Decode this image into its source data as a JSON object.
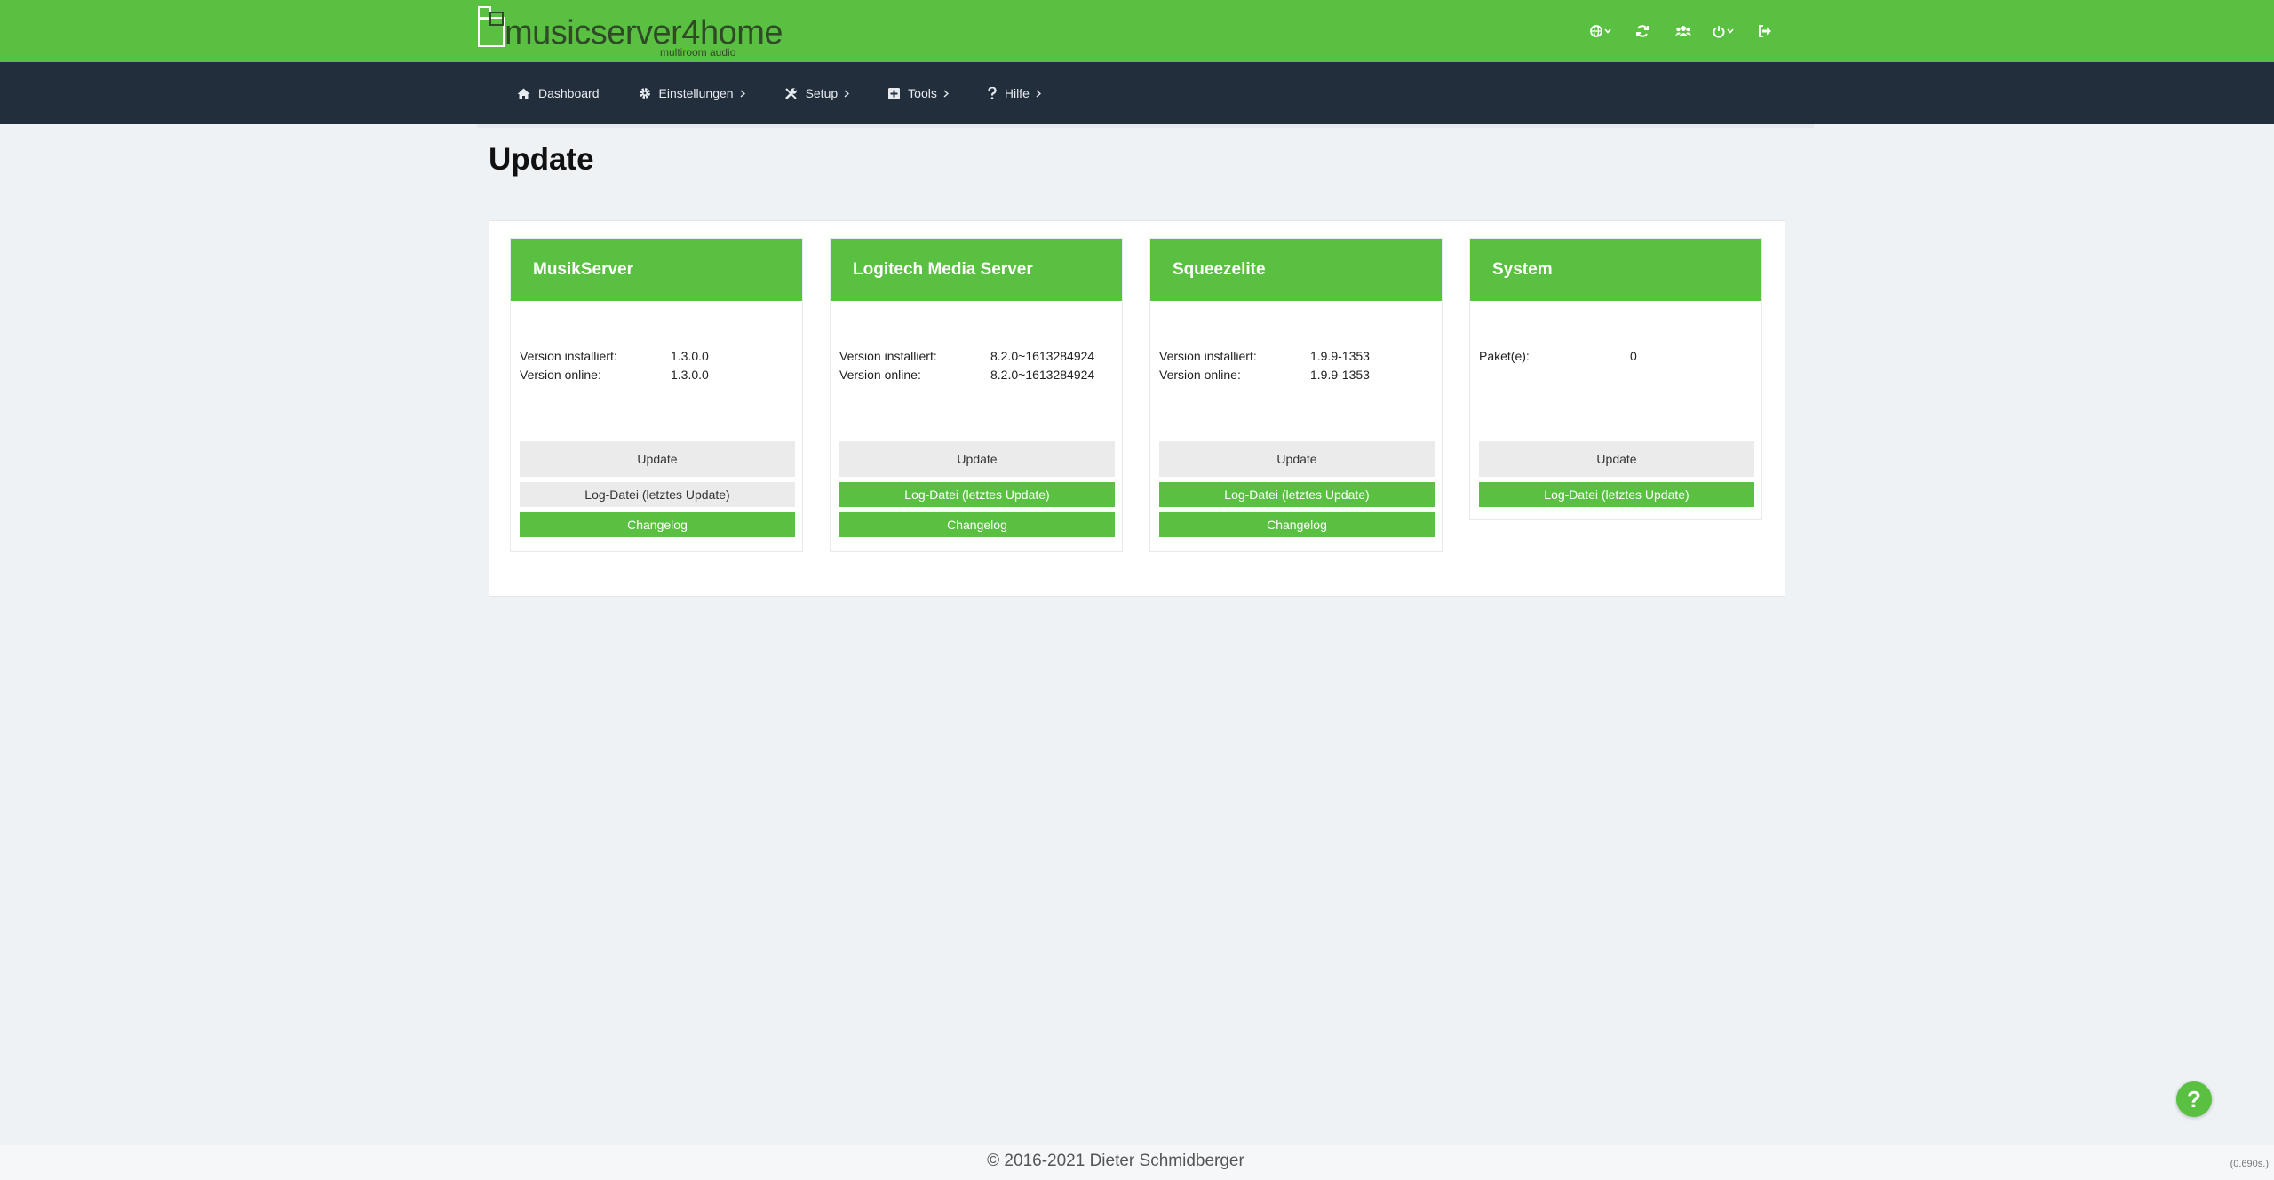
{
  "header": {
    "logo_text": "musicserver4home",
    "logo_subtitle": "multiroom audio",
    "icons": [
      "globe-icon",
      "refresh-icon",
      "users-icon",
      "power-icon",
      "logout-icon"
    ]
  },
  "nav": {
    "items": [
      {
        "label": "Dashboard",
        "icon": "home-icon"
      },
      {
        "label": "Einstellungen",
        "icon": "gear-icon"
      },
      {
        "label": "Setup",
        "icon": "wrench-icon"
      },
      {
        "label": "Tools",
        "icon": "plus-square-icon"
      },
      {
        "label": "Hilfe",
        "icon": "question-icon"
      }
    ]
  },
  "page": {
    "title": "Update"
  },
  "cards": [
    {
      "title": "MusikServer",
      "rows": [
        {
          "key": "Version installiert:",
          "value": "1.3.0.0"
        },
        {
          "key": "Version online:",
          "value": "1.3.0.0"
        }
      ],
      "update_label": "Update",
      "log_label": "Log-Datei (letztes Update)",
      "changelog_label": "Changelog"
    },
    {
      "title": "Logitech Media Server",
      "rows": [
        {
          "key": "Version installiert:",
          "value": "8.2.0~1613284924"
        },
        {
          "key": "Version online:",
          "value": "8.2.0~1613284924"
        }
      ],
      "update_label": "Update",
      "log_label": "Log-Datei (letztes Update)",
      "changelog_label": "Changelog"
    },
    {
      "title": "Squeezelite",
      "rows": [
        {
          "key": "Version installiert:",
          "value": "1.9.9-1353"
        },
        {
          "key": "Version online:",
          "value": "1.9.9-1353"
        }
      ],
      "update_label": "Update",
      "log_label": "Log-Datei (letztes Update)",
      "changelog_label": "Changelog"
    },
    {
      "title": "System",
      "rows": [
        {
          "key": "Paket(e):",
          "value": "0"
        }
      ],
      "update_label": "Update",
      "log_label": "Log-Datei (letztes Update)"
    }
  ],
  "footer": {
    "copyright": "© 2016-2021 Dieter Schmidberger",
    "timing": "(0.690s.)"
  },
  "help_button": "?",
  "colors": {
    "brand_green": "#5ac041",
    "nav_dark": "#232e3d"
  }
}
